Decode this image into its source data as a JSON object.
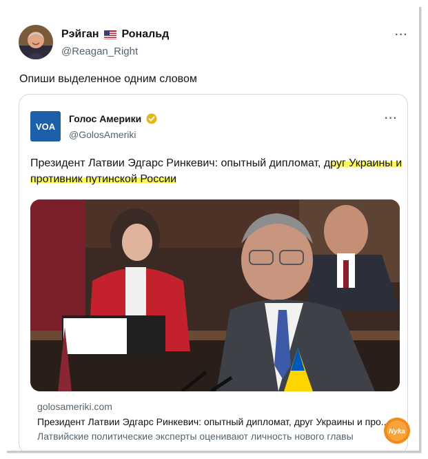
{
  "tweet": {
    "author_name_part1": "Рэйган",
    "author_name_part2": "Рональд",
    "author_handle": "@Reagan_Right",
    "more_glyph": "···",
    "text": "Опиши выделенное одним словом"
  },
  "quoted": {
    "logo_text": "VOA",
    "name": "Голос Америки",
    "handle": "@GolosAmeriki",
    "more_glyph": "···",
    "text_before": "Президент Латвии Эдгарс Ринкевич: опытный дипломат, д",
    "text_highlight_1": "руг Украины и",
    "text_highlight_2": "противник путинской России",
    "card": {
      "domain": "golosameriki.com",
      "title": "Президент Латвии Эдгарс Ринкевич: опытный дипломат, друг Украины и про...",
      "description": "Латвийские политические эксперты оценивают личность нового главы"
    }
  },
  "watermark": {
    "text": "Nyka"
  },
  "colors": {
    "highlight": "#fdf65a",
    "voa_blue": "#1b60a8",
    "verified_gold": "#e2b719",
    "secondary_text": "#536471",
    "border": "#cfd9de"
  },
  "icons": {
    "flag": "us-flag-icon",
    "verified": "verified-badge-icon",
    "more": "more-icon"
  }
}
